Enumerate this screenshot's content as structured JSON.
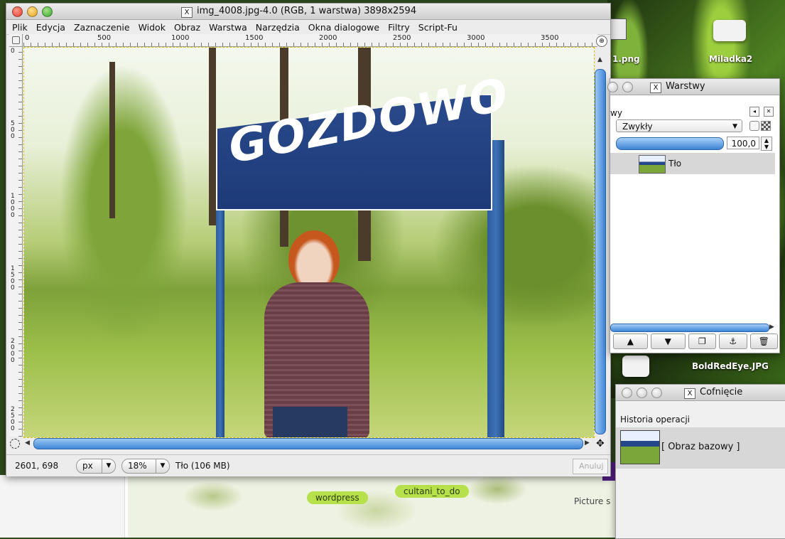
{
  "desktop": {
    "icons": [
      {
        "label": "1.png"
      },
      {
        "label": "Miladka2"
      },
      {
        "label": "BoldRedEye.JPG"
      }
    ],
    "tags": [
      "wordpress",
      "cultani_to_do"
    ],
    "picture_text": "Picture s"
  },
  "gimp": {
    "title": "img_4008.jpg-4.0 (RGB, 1 warstwa) 3898x2594",
    "menu": [
      "Plik",
      "Edycja",
      "Zaznaczenie",
      "Widok",
      "Obraz",
      "Warstwa",
      "Narzędzia",
      "Okna dialogowe",
      "Filtry",
      "Script-Fu"
    ],
    "ruler_top": [
      "0",
      "500",
      "1000",
      "1500",
      "2000",
      "2500",
      "3000",
      "3500"
    ],
    "ruler_left": [
      "0",
      "500",
      "1000",
      "1500",
      "2000",
      "2500"
    ],
    "sign_text": "GOZDOWO",
    "status": {
      "coords": "2601, 698",
      "unit": "px",
      "zoom": "18%",
      "layer_info": "Tło (106 MB)",
      "cancel": "Anuluj"
    }
  },
  "layers": {
    "title": "Warstwy",
    "tab_label": "wy",
    "mode": "Zwykły",
    "opacity": "100,0",
    "opacity_level": 1.0,
    "layer_name": "Tło"
  },
  "undo": {
    "title": "Cofnięcie",
    "section_label": "Historia operacji",
    "item": "[ Obraz bazowy ]"
  }
}
